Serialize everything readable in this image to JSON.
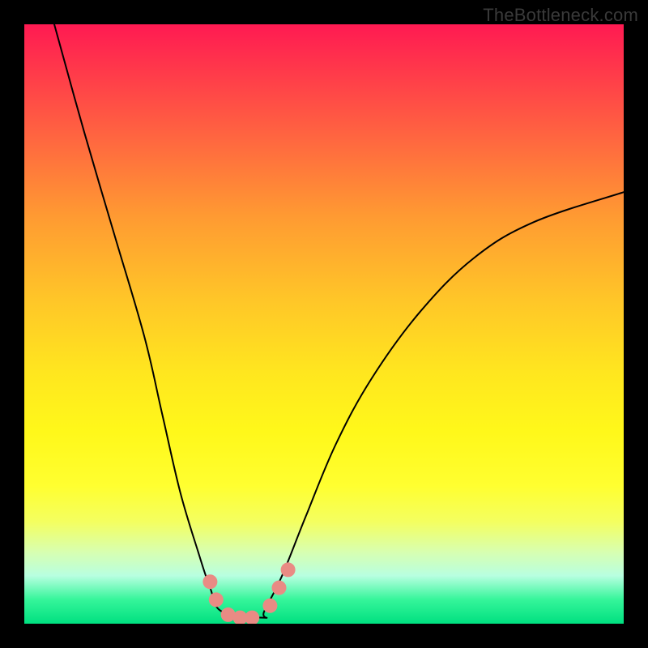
{
  "watermark": "TheBottleneck.com",
  "chart_data": {
    "type": "line",
    "title": "",
    "xlabel": "",
    "ylabel": "",
    "xlim": [
      0,
      100
    ],
    "ylim": [
      0,
      100
    ],
    "grid": false,
    "curve_left": {
      "name": "left-branch",
      "x": [
        5,
        10,
        15,
        20,
        23,
        26,
        29,
        31,
        33
      ],
      "y": [
        100,
        82,
        65,
        48,
        35,
        22,
        12,
        6,
        2
      ]
    },
    "curve_right": {
      "name": "right-branch",
      "x": [
        40,
        43,
        47,
        52,
        58,
        66,
        75,
        85,
        100
      ],
      "y": [
        2,
        8,
        18,
        30,
        41,
        52,
        61,
        67,
        72
      ]
    },
    "flat_segment": {
      "x": [
        33,
        40
      ],
      "y": [
        1,
        1
      ]
    },
    "markers": {
      "name": "highlight-points",
      "color": "#e98b84",
      "points": [
        {
          "x": 31,
          "y": 7
        },
        {
          "x": 32,
          "y": 4
        },
        {
          "x": 34,
          "y": 1.5
        },
        {
          "x": 36,
          "y": 1
        },
        {
          "x": 38,
          "y": 1
        },
        {
          "x": 41,
          "y": 3
        },
        {
          "x": 42.5,
          "y": 6
        },
        {
          "x": 44,
          "y": 9
        }
      ]
    }
  }
}
